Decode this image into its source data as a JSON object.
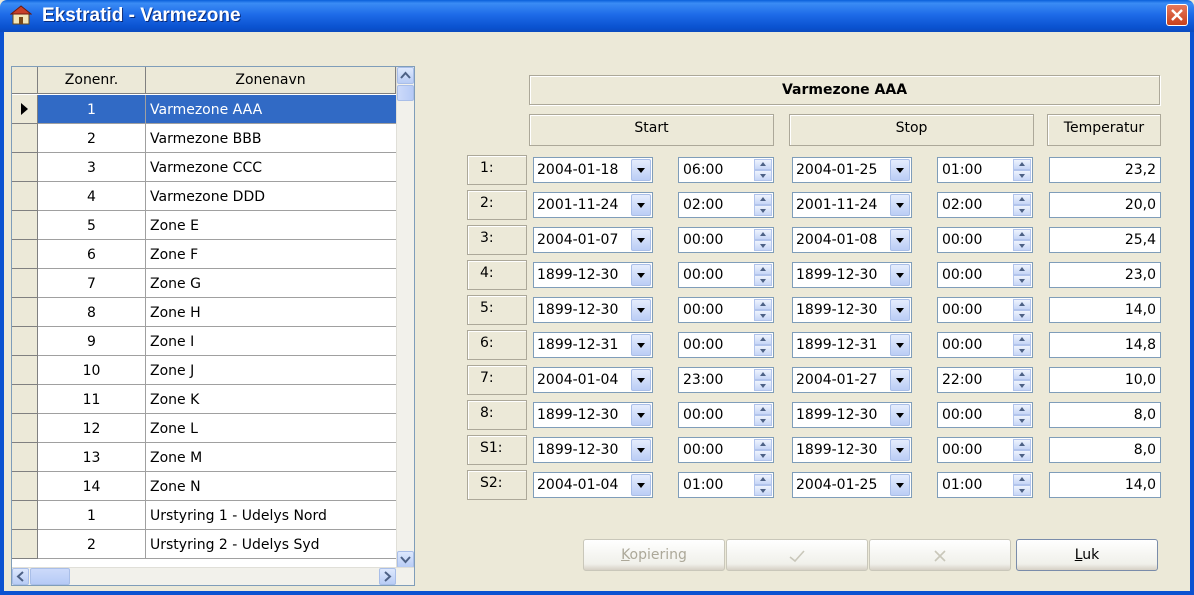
{
  "window": {
    "title": "Ekstratid - Varmezone"
  },
  "grid": {
    "headers": [
      "Zonenr.",
      "Zonenavn"
    ],
    "rows": [
      {
        "num": "1",
        "name": "Varmezone AAA"
      },
      {
        "num": "2",
        "name": "Varmezone BBB"
      },
      {
        "num": "3",
        "name": "Varmezone CCC"
      },
      {
        "num": "4",
        "name": "Varmezone DDD"
      },
      {
        "num": "5",
        "name": "Zone E"
      },
      {
        "num": "6",
        "name": "Zone F"
      },
      {
        "num": "7",
        "name": "Zone G"
      },
      {
        "num": "8",
        "name": "Zone H"
      },
      {
        "num": "9",
        "name": "Zone I"
      },
      {
        "num": "10",
        "name": "Zone J"
      },
      {
        "num": "11",
        "name": "Zone K"
      },
      {
        "num": "12",
        "name": "Zone L"
      },
      {
        "num": "13",
        "name": "Zone M"
      },
      {
        "num": "14",
        "name": "Zone N"
      },
      {
        "num": "1",
        "name": "Urstyring 1 - Udelys Nord"
      },
      {
        "num": "2",
        "name": "Urstyring 2 - Udelys Syd"
      }
    ]
  },
  "panel": {
    "zone_title": "Varmezone AAA",
    "start_label": "Start",
    "stop_label": "Stop",
    "temp_label": "Temperatur",
    "entries": [
      {
        "label": "1:",
        "start_date": "2004-01-18",
        "start_time": "06:00",
        "stop_date": "2004-01-25",
        "stop_time": "01:00",
        "temp": "23,2"
      },
      {
        "label": "2:",
        "start_date": "2001-11-24",
        "start_time": "02:00",
        "stop_date": "2001-11-24",
        "stop_time": "02:00",
        "temp": "20,0"
      },
      {
        "label": "3:",
        "start_date": "2004-01-07",
        "start_time": "00:00",
        "stop_date": "2004-01-08",
        "stop_time": "00:00",
        "temp": "25,4"
      },
      {
        "label": "4:",
        "start_date": "1899-12-30",
        "start_time": "00:00",
        "stop_date": "1899-12-30",
        "stop_time": "00:00",
        "temp": "23,0"
      },
      {
        "label": "5:",
        "start_date": "1899-12-30",
        "start_time": "00:00",
        "stop_date": "1899-12-30",
        "stop_time": "00:00",
        "temp": "14,0"
      },
      {
        "label": "6:",
        "start_date": "1899-12-31",
        "start_time": "00:00",
        "stop_date": "1899-12-31",
        "stop_time": "00:00",
        "temp": "14,8"
      },
      {
        "label": "7:",
        "start_date": "2004-01-04",
        "start_time": "23:00",
        "stop_date": "2004-01-27",
        "stop_time": "22:00",
        "temp": "10,0"
      },
      {
        "label": "8:",
        "start_date": "1899-12-30",
        "start_time": "00:00",
        "stop_date": "1899-12-30",
        "stop_time": "00:00",
        "temp": "8,0"
      },
      {
        "label": "S1:",
        "start_date": "1899-12-30",
        "start_time": "00:00",
        "stop_date": "1899-12-30",
        "stop_time": "00:00",
        "temp": "8,0"
      },
      {
        "label": "S2:",
        "start_date": "2004-01-04",
        "start_time": "01:00",
        "stop_date": "2004-01-25",
        "stop_time": "01:00",
        "temp": "14,0"
      }
    ]
  },
  "buttons": {
    "copy_rest": "opiering",
    "copy_key": "K",
    "close_rest": "uk",
    "close_key": "L"
  }
}
